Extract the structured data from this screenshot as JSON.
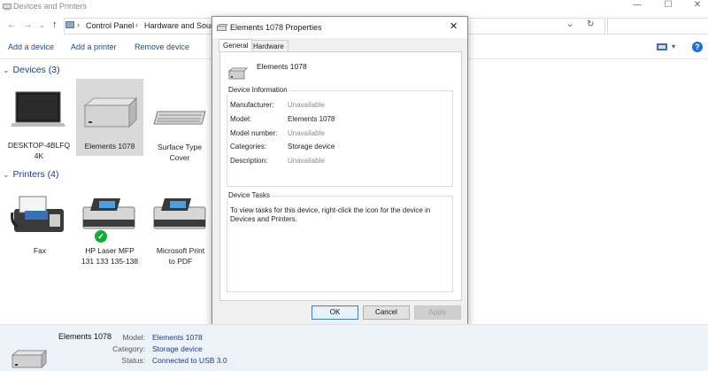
{
  "window": {
    "title": "Devices and Printers"
  },
  "address": {
    "crumbs": [
      "Control Panel",
      "Hardware and Sound"
    ]
  },
  "toolbar": {
    "add_device": "Add a device",
    "add_printer": "Add a printer",
    "remove_device": "Remove device"
  },
  "devices": {
    "header": "Devices (3)",
    "items": [
      {
        "label": "DESKTOP-4BLFQ\n4K",
        "icon": "laptop-icon"
      },
      {
        "label": "Elements 1078",
        "icon": "external-drive-icon",
        "selected": true
      },
      {
        "label": "Surface Type\nCover",
        "icon": "keyboard-icon"
      }
    ]
  },
  "printers": {
    "header": "Printers (4)",
    "items": [
      {
        "label": "Fax",
        "icon": "fax-icon"
      },
      {
        "label": "HP Laser MFP\n131 133 135-138",
        "icon": "printer-icon",
        "default": true
      },
      {
        "label": "Microsoft Print\nto PDF",
        "icon": "printer-icon"
      }
    ]
  },
  "dialog": {
    "title": "Elements 1078 Properties",
    "tabs": [
      "General",
      "Hardware"
    ],
    "device_name": "Elements 1078",
    "info_legend": "Device Information",
    "props": [
      {
        "label": "Manufacturer:",
        "value": "Unavailable",
        "muted": true
      },
      {
        "label": "Model:",
        "value": "Elements 1078",
        "muted": false
      },
      {
        "label": "Model number:",
        "value": "Unavailable",
        "muted": true
      },
      {
        "label": "Categories:",
        "value": "Storage device",
        "muted": false
      },
      {
        "label": "Description:",
        "value": "Unavailable",
        "muted": true
      }
    ],
    "tasks_legend": "Device Tasks",
    "tasks_text": "To view tasks for this device, right-click the icon for the device in Devices and Printers.",
    "ok": "OK",
    "cancel": "Cancel",
    "apply": "Apply",
    "close_glyph": "✕"
  },
  "details": {
    "name": "Elements 1078",
    "rows": [
      {
        "label": "Model:",
        "value": "Elements 1078"
      },
      {
        "label": "Category:",
        "value": "Storage device"
      },
      {
        "label": "Status:",
        "value": "Connected to USB 3.0"
      }
    ]
  },
  "colors": {
    "link": "#1a4d8c",
    "section": "#1e3d7a",
    "details_bg": "#edf2f9",
    "ok_border": "#3c7fb1",
    "default_check": "#1aa83a"
  }
}
